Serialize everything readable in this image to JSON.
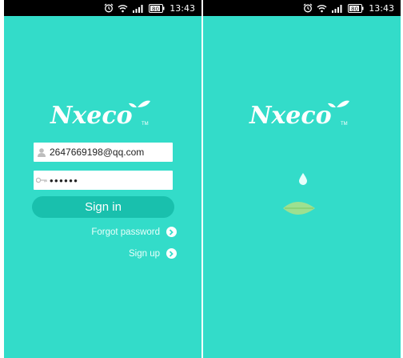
{
  "status_bar": {
    "time": "13:43",
    "battery": "80",
    "icons": [
      "alarm-icon",
      "wifi-icon",
      "signal-icon",
      "battery-icon"
    ]
  },
  "login": {
    "brand": "Nxeco",
    "trademark": "TM",
    "username_value": "2647669198@qq.com",
    "password_masked": "••••••",
    "sign_in_label": "Sign in",
    "forgot_label": "Forgot password",
    "signup_label": "Sign up"
  },
  "splash": {
    "brand": "Nxeco",
    "trademark": "TM"
  },
  "colors": {
    "background": "#33dcc9",
    "button": "#19c0ad",
    "statusbar": "#000000"
  }
}
